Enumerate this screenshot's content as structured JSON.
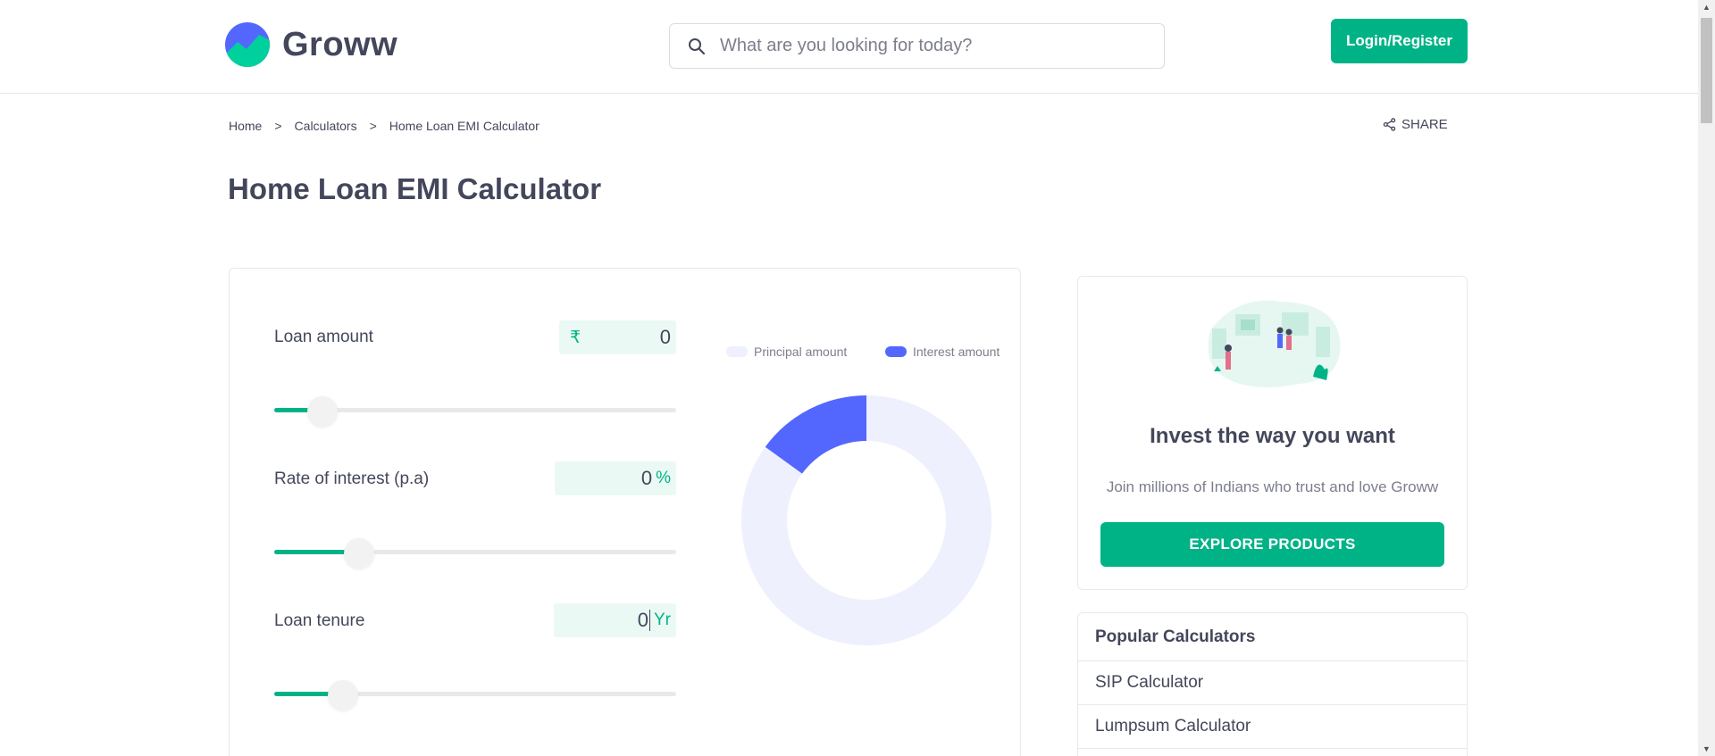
{
  "header": {
    "brand": "Groww",
    "search_placeholder": "What are you looking for today?",
    "login_label": "Login/Register"
  },
  "breadcrumb": {
    "items": [
      "Home",
      "Calculators",
      "Home Loan EMI Calculator"
    ],
    "separator": ">"
  },
  "share_label": "SHARE",
  "page_title": "Home Loan EMI Calculator",
  "calculator": {
    "loan_amount": {
      "label": "Loan amount",
      "prefix": "₹",
      "value": "0",
      "slider_fraction": 0.12
    },
    "rate_of_interest": {
      "label": "Rate of interest (p.a)",
      "value": "0",
      "suffix": "%",
      "slider_fraction": 0.21
    },
    "loan_tenure": {
      "label": "Loan tenure",
      "value": "0",
      "suffix": "Yr",
      "slider_fraction": 0.17
    }
  },
  "chart_data": {
    "type": "pie",
    "donut": true,
    "series": [
      {
        "name": "Principal amount",
        "value": 85,
        "color": "#eef0fd"
      },
      {
        "name": "Interest amount",
        "value": 15,
        "color": "#5367ff"
      }
    ],
    "legend_position": "top"
  },
  "invest_card": {
    "title": "Invest the way you want",
    "subtitle": "Join millions of Indians who trust and love Groww",
    "button_label": "EXPLORE PRODUCTS"
  },
  "popular_calculators": {
    "title": "Popular Calculators",
    "items": [
      "SIP Calculator",
      "Lumpsum Calculator"
    ]
  },
  "colors": {
    "accent": "#00b386",
    "brand_blue": "#5367ff",
    "text": "#44475b",
    "muted": "#7c7e8c"
  }
}
